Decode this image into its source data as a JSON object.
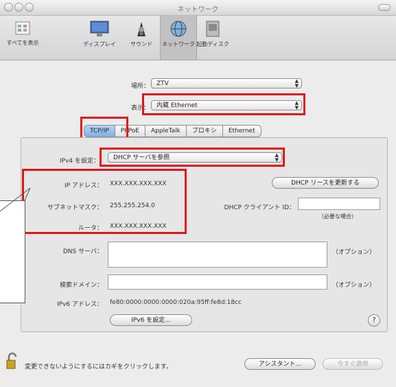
{
  "window": {
    "title": "ネットワーク"
  },
  "toolbar": {
    "items": [
      {
        "label": "すべてを表示",
        "icon": "grid-icon"
      },
      {
        "label": "ディスプレイ",
        "icon": "display-icon"
      },
      {
        "label": "サウンド",
        "icon": "speaker-icon"
      },
      {
        "label": "ネットワーク",
        "icon": "globe-icon",
        "selected": true
      },
      {
        "label": "起動ディスク",
        "icon": "disk-icon"
      }
    ]
  },
  "location": {
    "label": "場所：",
    "value": "ZTV"
  },
  "show": {
    "label": "表示：",
    "value": "内蔵 Ethernet"
  },
  "tabs": [
    "TCP/IP",
    "PPPoE",
    "AppleTalk",
    "プロキシ",
    "Ethernet"
  ],
  "ipv4": {
    "label": "IPv4 を設定：",
    "value": "DHCP サーバを参照"
  },
  "ip": {
    "label": "IP アドレス：",
    "value": "XXX.XXX.XXX.XXX"
  },
  "subnet": {
    "label": "サブネットマスク：",
    "value": "255.255.254.0"
  },
  "router": {
    "label": "ルータ：",
    "value": "XXX.XXX.XXX.XXX"
  },
  "dhcp": {
    "renew_button": "DHCP リースを更新する",
    "client_id_label": "DHCP クライアント ID：",
    "client_id_note": "（必要な場合）",
    "client_id_value": ""
  },
  "dns": {
    "label": "DNS サーバ：",
    "note": "（オプション）",
    "value": ""
  },
  "search": {
    "label": "検索ドメイン：",
    "note": "（オプション）",
    "value": ""
  },
  "ipv6": {
    "label": "IPv6 アドレス：",
    "value": "fe80:0000:0000:0000:020a:95ff:fe8d:18cc",
    "button": "IPv6 を設定..."
  },
  "help": {
    "label": "?"
  },
  "footer": {
    "lock_text": "変更できないようにするにはカギをクリックします。",
    "assistant_button": "アシスタント...",
    "apply_button": "今すぐ適用"
  },
  "colors": {
    "highlight": "#e0141a",
    "tab_active": "#80aee6"
  }
}
